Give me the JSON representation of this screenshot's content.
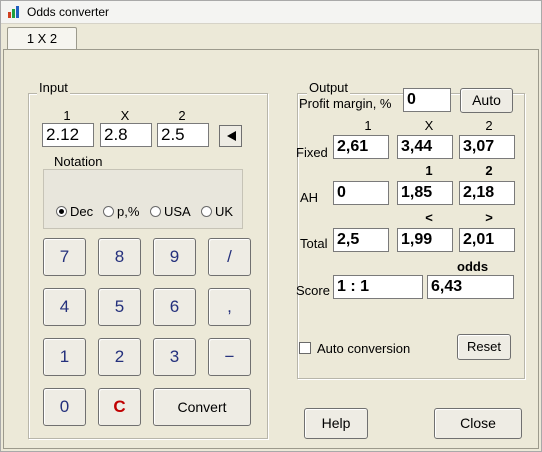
{
  "window": {
    "title": "Odds converter"
  },
  "tabs": [
    {
      "label": "1 X 2"
    }
  ],
  "input": {
    "group_label": "Input",
    "col_headers": [
      "1",
      "X",
      "2"
    ],
    "values": [
      "2.12",
      "2.8",
      "2.5"
    ],
    "notation_label": "Notation",
    "notation_options": [
      "Dec",
      "p,%",
      "USA",
      "UK"
    ],
    "notation_selected": "Dec"
  },
  "keypad": {
    "rows": [
      [
        "7",
        "8",
        "9",
        "/"
      ],
      [
        "4",
        "5",
        "6",
        ","
      ],
      [
        "1",
        "2",
        "3",
        "−"
      ],
      [
        "0",
        "C"
      ]
    ],
    "convert_label": "Convert"
  },
  "output": {
    "group_label": "Output",
    "profit_margin_label": "Profit margin, %",
    "profit_margin_value": "0",
    "auto_label": "Auto",
    "fixed": {
      "label": "Fixed",
      "headers": [
        "1",
        "X",
        "2"
      ],
      "values": [
        "2,61",
        "3,44",
        "3,07"
      ]
    },
    "ah": {
      "label": "AH",
      "headers": [
        "1",
        "2"
      ],
      "values": [
        "0",
        "1,85",
        "2,18"
      ]
    },
    "total": {
      "label": "Total",
      "headers": [
        "<",
        ">"
      ],
      "values": [
        "2,5",
        "1,99",
        "2,01"
      ]
    },
    "score": {
      "label": "Score",
      "header": "odds",
      "value": "1 : 1",
      "odds": "6,43"
    },
    "auto_conversion_label": "Auto conversion",
    "auto_conversion_checked": false,
    "reset_label": "Reset"
  },
  "footer": {
    "help_label": "Help",
    "close_label": "Close"
  }
}
